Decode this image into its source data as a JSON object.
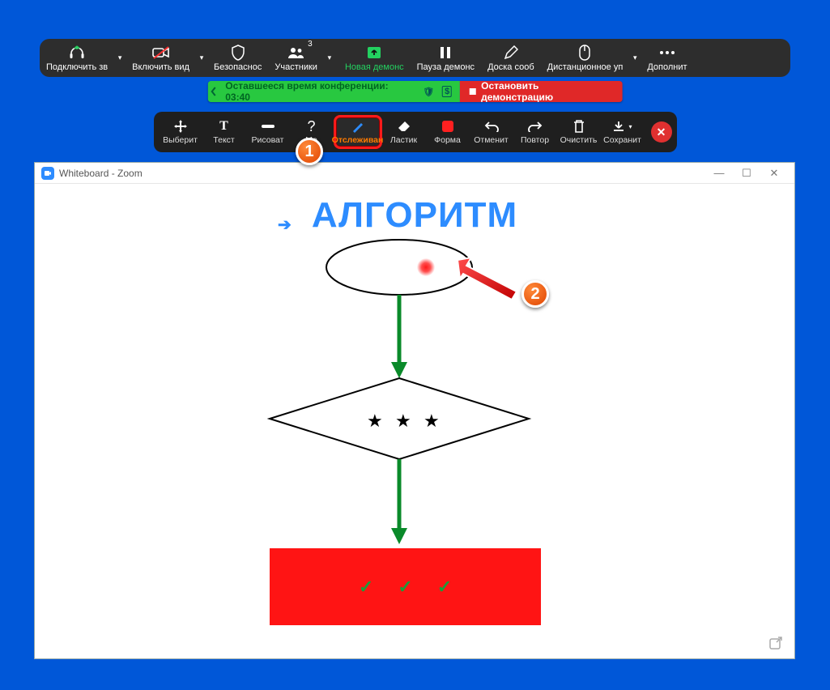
{
  "main_toolbar": {
    "audio": "Подключить зв",
    "video": "Включить вид",
    "security": "Безопаснос",
    "participants": "Участники",
    "participants_count": "3",
    "new_share": "Новая демонс",
    "pause_share": "Пауза демонс",
    "whiteboard": "Доска сооб",
    "remote_control": "Дистанционное уп",
    "more": "Дополнит"
  },
  "timer_bar": {
    "remaining": "Оставшееся время конференции: 03:40",
    "stop": "Остановить демонстрацию"
  },
  "anno_toolbar": {
    "select": "Выберит",
    "text": "Текст",
    "draw": "Рисоват",
    "stamp": "Ме",
    "spotlight": "Отслеживан",
    "eraser": "Ластик",
    "format": "Форма",
    "undo": "Отменит",
    "redo": "Повтор",
    "clear": "Очистить",
    "save": "Сохранит"
  },
  "step_labels": {
    "one": "1",
    "two": "2"
  },
  "whiteboard": {
    "window_title": "Whiteboard - Zoom",
    "heading": "АЛГОРИТМ"
  }
}
